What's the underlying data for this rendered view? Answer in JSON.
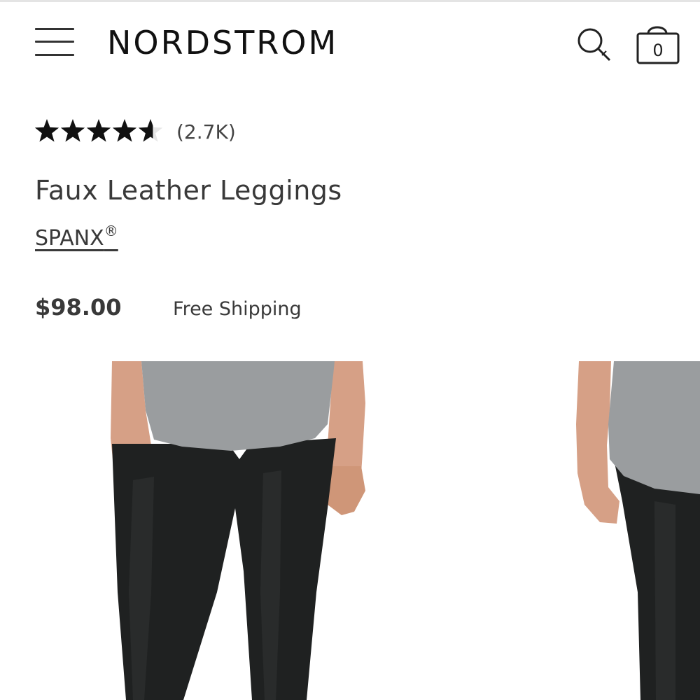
{
  "header": {
    "logo": "NORDSTROM",
    "menu_icon": "hamburger-menu-icon",
    "search_icon": "search-icon",
    "bag_icon": "shopping-bag-icon",
    "bag_count": "0"
  },
  "product": {
    "rating": 4.6,
    "rating_max": 5,
    "review_count": "(2.7K)",
    "title": "Faux Leather Leggings",
    "brand": "SPANX",
    "brand_mark": "®",
    "price": "$98.00",
    "shipping": "Free Shipping"
  },
  "gallery": {
    "images": [
      "product-front-photo",
      "product-side-photo"
    ]
  },
  "colors": {
    "text": "#393939",
    "logo": "#111111",
    "star": "#111111",
    "star_empty": "#e6e6e6",
    "shirt": "#9a9d9f",
    "leggings": "#1e2020",
    "skin": "#d9a58c"
  }
}
